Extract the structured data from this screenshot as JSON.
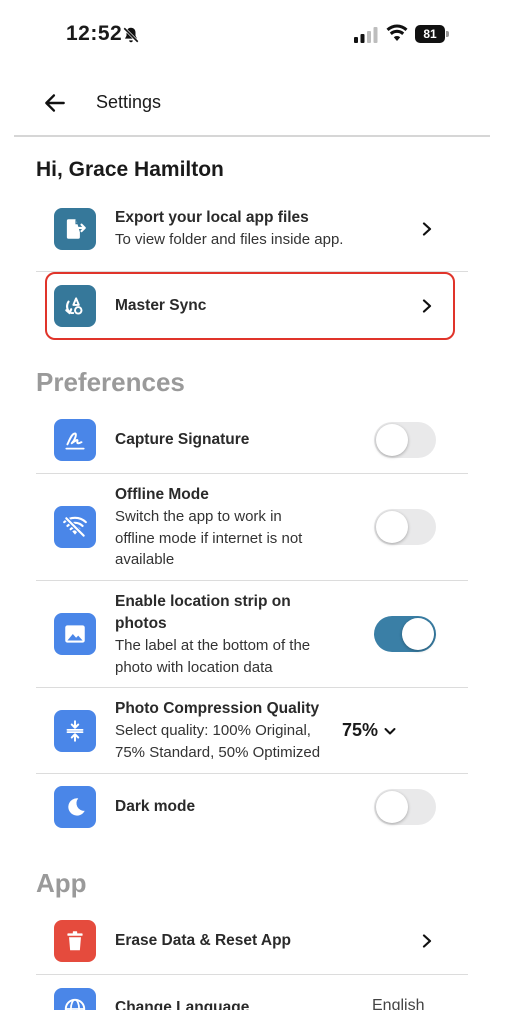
{
  "status_bar": {
    "time": "12:52",
    "battery": "81"
  },
  "header": {
    "title": "Settings"
  },
  "greeting": "Hi, Grace Hamilton",
  "account_items": [
    {
      "title": "Export your local app files",
      "subtitle": "To view folder and files inside app.",
      "icon": "export-file-icon"
    },
    {
      "title": "Master Sync",
      "icon": "sync-icon"
    }
  ],
  "preferences": {
    "title": "Preferences",
    "items": [
      {
        "title": "Capture Signature",
        "icon": "signature-icon",
        "enabled": false
      },
      {
        "title": "Offline Mode",
        "subtitle_lines": [
          "Switch the app to work in",
          "offline mode if internet is not",
          "available"
        ],
        "icon": "wifi-off-icon",
        "enabled": false
      },
      {
        "title_lines": [
          "Enable location strip on",
          "photos"
        ],
        "subtitle_lines": [
          "The label at the bottom of the",
          "photo with location data"
        ],
        "icon": "image-icon",
        "enabled": true
      },
      {
        "title": "Photo Compression Quality",
        "subtitle_lines": [
          "Select quality: 100% Original,",
          "75% Standard, 50% Optimized"
        ],
        "icon": "compress-icon",
        "value": "75%"
      },
      {
        "title": "Dark mode",
        "icon": "moon-icon",
        "enabled": false
      }
    ]
  },
  "app": {
    "title": "App",
    "items": [
      {
        "title": "Erase Data & Reset App",
        "icon": "trash-icon"
      },
      {
        "title": "Change Language",
        "icon": "globe-icon",
        "value": "English"
      }
    ]
  },
  "colors": {
    "accent": "#36789a",
    "icon_blue": "#4a86e8",
    "danger": "#e54b3d",
    "highlight": "#e0342a"
  }
}
